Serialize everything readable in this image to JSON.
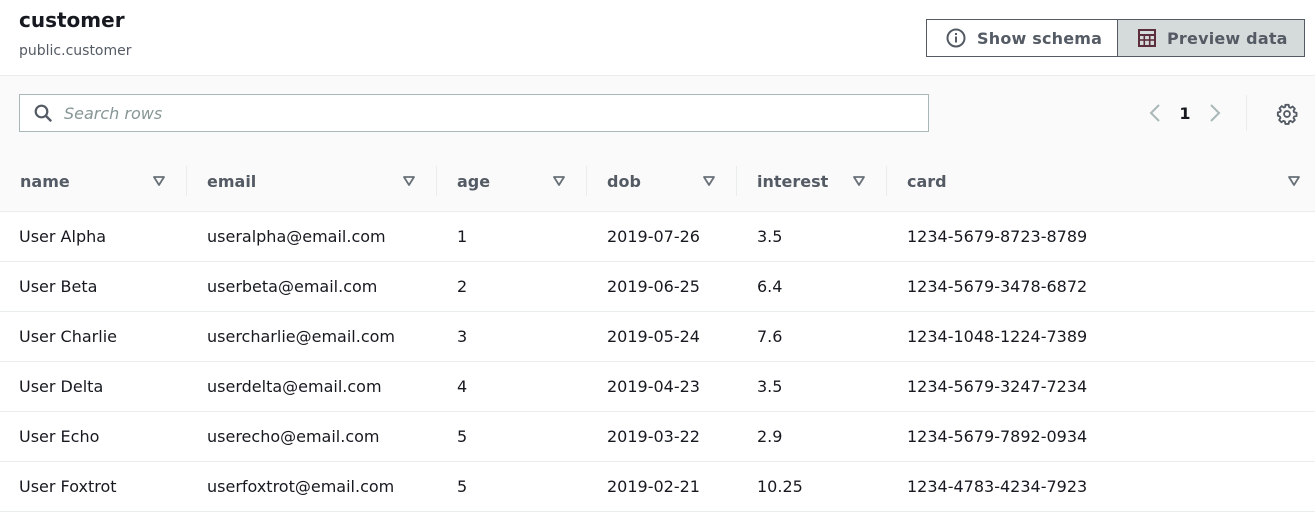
{
  "header": {
    "title": "customer",
    "subtitle": "public.customer",
    "show_schema_label": "Show schema",
    "preview_data_label": "Preview data"
  },
  "toolbar": {
    "search_placeholder": "Search rows",
    "current_page": "1"
  },
  "table": {
    "columns": [
      "name",
      "email",
      "age",
      "dob",
      "interest",
      "card"
    ],
    "rows": [
      [
        "User Alpha",
        "useralpha@email.com",
        "1",
        "2019-07-26",
        "3.5",
        "1234-5679-8723-8789"
      ],
      [
        "User Beta",
        "userbeta@email.com",
        "2",
        "2019-06-25",
        "6.4",
        "1234-5679-3478-6872"
      ],
      [
        "User Charlie",
        "usercharlie@email.com",
        "3",
        "2019-05-24",
        "7.6",
        "1234-1048-1224-7389"
      ],
      [
        "User Delta",
        "userdelta@email.com",
        "4",
        "2019-04-23",
        "3.5",
        "1234-5679-3247-7234"
      ],
      [
        "User Echo",
        "userecho@email.com",
        "5",
        "2019-03-22",
        "2.9",
        "1234-5679-7892-0934"
      ],
      [
        "User Foxtrot",
        "userfoxtrot@email.com",
        "5",
        "2019-02-21",
        "10.25",
        "1234-4783-4234-7923"
      ]
    ]
  },
  "icons": {
    "info": "info-circle-icon",
    "table": "table-grid-icon",
    "search": "search-icon",
    "prev": "chevron-left-icon",
    "next": "chevron-right-icon",
    "settings": "gear-icon",
    "filter": "caret-down-icon"
  },
  "colors": {
    "text": "#16191f",
    "secondary_text": "#545b64",
    "border": "#eaeded",
    "selected_segment": "#d5dbdb",
    "table_icon": "#5c2d3a"
  }
}
